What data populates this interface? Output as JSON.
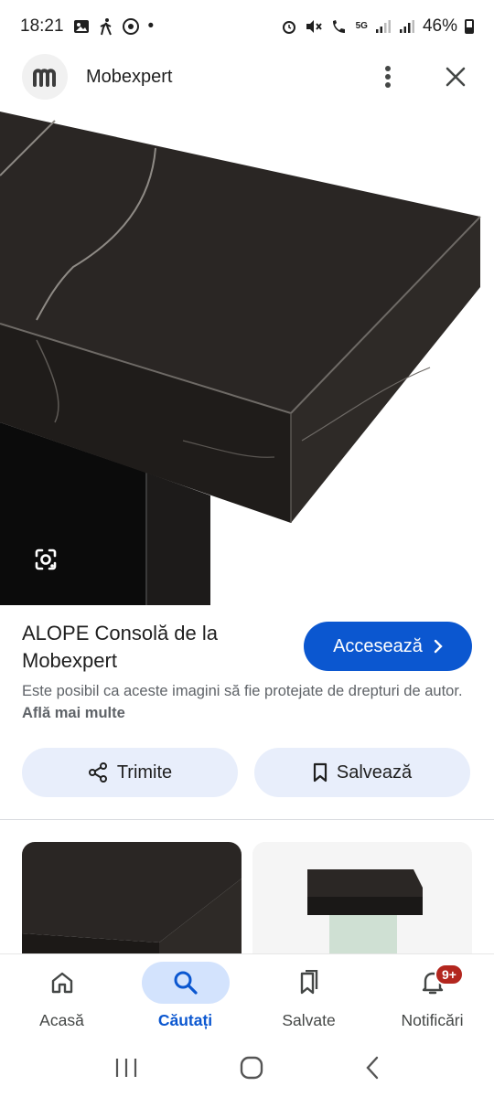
{
  "status_bar": {
    "time": "18:21",
    "dot": "•",
    "battery_percent": "46%",
    "network_label": "5G",
    "left_icons": [
      "gallery-icon",
      "walk-icon",
      "chrome-icon"
    ],
    "right_icons": [
      "alarm-icon",
      "mute-icon",
      "wifi-call-icon",
      "signal-icon",
      "signal-icon",
      "battery-icon"
    ]
  },
  "header": {
    "logo_letter": "m",
    "site_name": "Mobexpert",
    "more_icon": "more-vert-icon",
    "close_icon": "close-icon"
  },
  "hero": {
    "lens_icon": "google-lens-icon"
  },
  "result": {
    "title": "ALOPE Consolă de la Mobexpert",
    "visit_label": "Accesează",
    "copyright_text": "Este posibil ca aceste imagini să fie protejate de drepturi de autor.",
    "learn_more": "Află mai multe"
  },
  "actions": {
    "share_label": "Trimite",
    "save_label": "Salvează"
  },
  "bottom_nav": {
    "items": [
      {
        "label": "Acasă",
        "icon": "home-icon"
      },
      {
        "label": "Căutați",
        "icon": "search-icon",
        "active": true
      },
      {
        "label": "Salvate",
        "icon": "bookmarks-icon"
      },
      {
        "label": "Notificări",
        "icon": "bell-icon",
        "badge": "9+"
      }
    ]
  },
  "colors": {
    "accent": "#0b57d0",
    "chip_bg": "#e8eefb",
    "active_pill": "#d3e3fd",
    "badge": "#b3261e"
  }
}
